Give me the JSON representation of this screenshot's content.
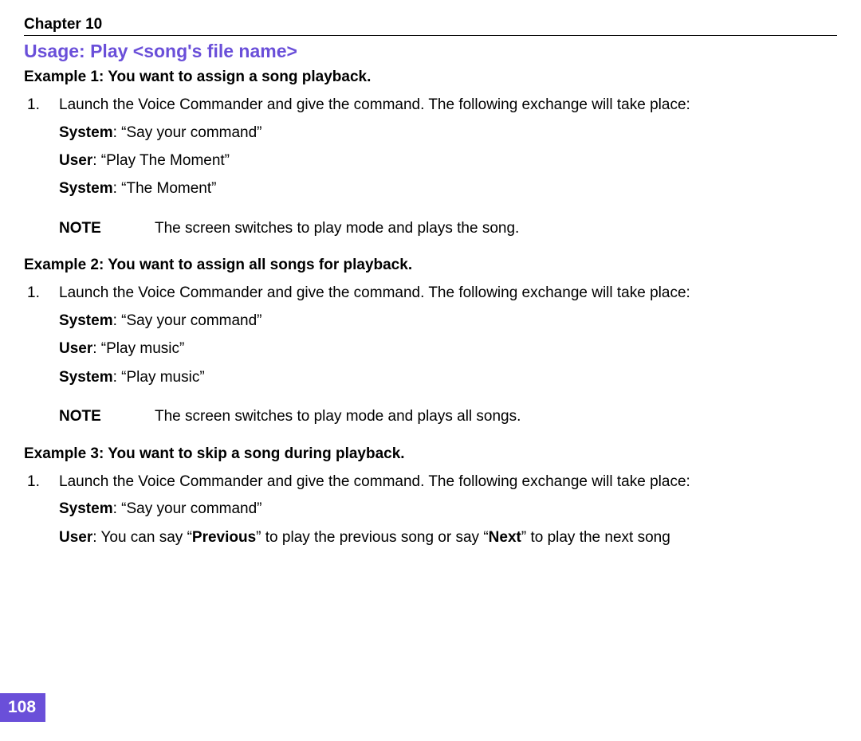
{
  "chapter_header": "Chapter 10",
  "section_title": "Usage: Play <song's file name>",
  "note_label": "NOTE",
  "step_number": "1.",
  "step_text": "Launch the Voice Commander and give the command. The following exchange will take place:",
  "labels": {
    "system": "System",
    "user": "User",
    "previous": "Previous",
    "next": "Next"
  },
  "example1": {
    "title": "Example 1: You want to assign a song playback.",
    "exchange": [
      {
        "speaker": "system",
        "text": ": “Say your command”"
      },
      {
        "speaker": "user",
        "text": ": “Play The Moment”"
      },
      {
        "speaker": "system",
        "text": ": “The Moment”"
      }
    ],
    "note_text": "The screen switches to play mode and plays the song."
  },
  "example2": {
    "title": "Example 2: You want to assign all songs for playback.",
    "exchange": [
      {
        "speaker": "system",
        "text": ": “Say your command”"
      },
      {
        "speaker": "user",
        "text": ": “Play music”"
      },
      {
        "speaker": "system",
        "text": ": “Play music”"
      }
    ],
    "note_text": "The screen switches to play mode and plays all songs."
  },
  "example3": {
    "title": "Example 3: You want to skip a song during playback.",
    "system_line": ": “Say your command”",
    "user_prefix": ": You can say “",
    "user_mid": "” to play the previous song or say “",
    "user_suffix": "” to play the next song"
  },
  "page_number": "108"
}
